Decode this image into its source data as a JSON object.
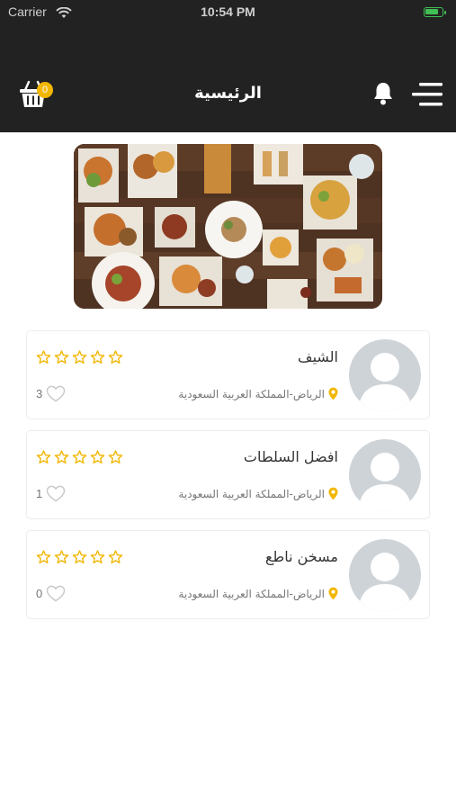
{
  "status_bar": {
    "carrier": "Carrier",
    "time": "10:54 PM"
  },
  "header": {
    "title": "الرئيسية",
    "cart_count": "0"
  },
  "colors": {
    "header_bg": "#222222",
    "accent": "#f2b705",
    "card_border": "#ececec"
  },
  "icons": {
    "cart": "shopping-basket-icon",
    "bell": "bell-icon",
    "menu": "hamburger-menu-icon",
    "pin": "map-pin-icon",
    "heart": "heart-outline-icon",
    "star": "star-outline-icon"
  },
  "restaurants": [
    {
      "name": "الشيف",
      "location": "الرياض-المملكة العربية السعودية",
      "likes": "3",
      "rating": 0
    },
    {
      "name": "افضل السلطات",
      "location": "الرياض-المملكة العربية السعودية",
      "likes": "1",
      "rating": 0
    },
    {
      "name": "مسخن ناطع",
      "location": "الرياض-المملكة العربية السعودية",
      "likes": "0",
      "rating": 0
    }
  ]
}
